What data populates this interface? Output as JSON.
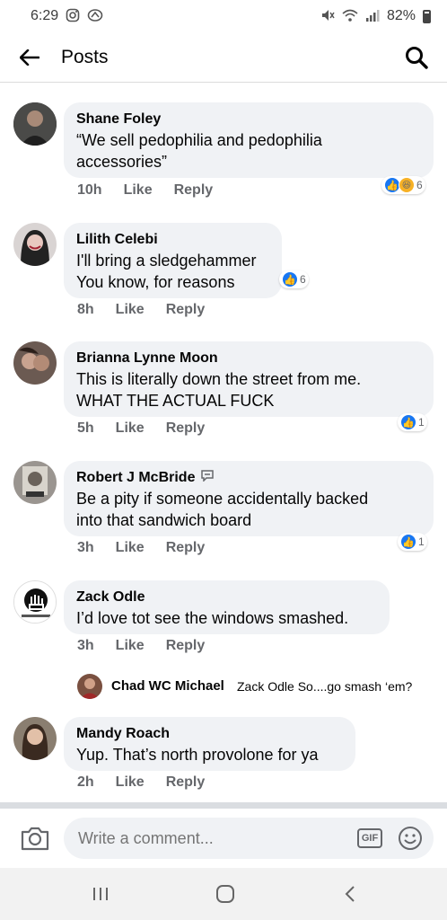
{
  "status_bar": {
    "time": "6:29",
    "battery": "82%"
  },
  "header": {
    "title": "Posts"
  },
  "comments": [
    {
      "author": "Shane Foley",
      "lines": [
        "“We sell pedophilia and pedophilia",
        "accessories”"
      ],
      "time": "10h",
      "like_label": "Like",
      "reply_label": "Reply",
      "reaction_count": "6",
      "reactions": [
        "like-icon",
        "haha-icon"
      ]
    },
    {
      "author": "Lilith Celebi",
      "lines": [
        "I'll bring a sledgehammer",
        "You know, for reasons"
      ],
      "time": "8h",
      "like_label": "Like",
      "reply_label": "Reply",
      "reaction_count": "6",
      "reactions": [
        "like-icon"
      ]
    },
    {
      "author": "Brianna Lynne Moon",
      "lines": [
        "This is literally down the street from me.",
        "WHAT THE ACTUAL FUCK"
      ],
      "time": "5h",
      "like_label": "Like",
      "reply_label": "Reply",
      "reaction_count": "1",
      "reactions": [
        "like-icon"
      ]
    },
    {
      "author": "Robert J McBride",
      "lines": [
        "Be a pity if someone accidentally backed",
        "into that sandwich board"
      ],
      "time": "3h",
      "like_label": "Like",
      "reply_label": "Reply",
      "reaction_count": "1",
      "reactions": [
        "like-icon"
      ]
    },
    {
      "author": "Zack Odle",
      "lines": [
        "I’d love tot see the windows smashed."
      ],
      "time": "3h",
      "like_label": "Like",
      "reply_label": "Reply"
    },
    {
      "author": "Mandy Roach",
      "lines": [
        "Yup. That’s north provolone for ya"
      ],
      "time": "2h",
      "like_label": "Like",
      "reply_label": "Reply"
    }
  ],
  "reply": {
    "author": "Chad WC Michael",
    "text": "Zack Odle So....go smash ‘em?"
  },
  "composer": {
    "placeholder": "Write a comment...",
    "gif_label": "GIF"
  },
  "colors": {
    "bubble": "#f0f2f5",
    "like_blue": "#1877f2",
    "meta_gray": "#65676b"
  }
}
